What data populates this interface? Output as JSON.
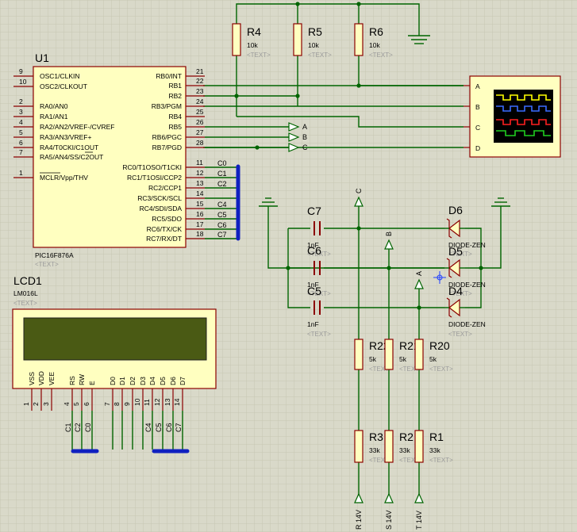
{
  "u1": {
    "ref": "U1",
    "part": "PIC16F876A",
    "placeholder": "<TEXT>",
    "left_pins": [
      {
        "num": "9",
        "name": "OSC1/CLKIN"
      },
      {
        "num": "10",
        "name": "OSC2/CLKOUT"
      },
      {
        "num": "2",
        "name": "RA0/AN0"
      },
      {
        "num": "3",
        "name": "RA1/AN1"
      },
      {
        "num": "4",
        "name": "RA2/AN2/VREF-/CVREF"
      },
      {
        "num": "5",
        "name": "RA3/AN3/VREF+"
      },
      {
        "num": "6",
        "name": "RA4/T0CKI/C1OUT"
      },
      {
        "num": "7",
        "name": "RA5/AN4/SS/C2OUT"
      },
      {
        "num": "1",
        "name": "MCLR/Vpp/THV"
      }
    ],
    "right_pins": [
      {
        "num": "21",
        "name": "RB0/INT"
      },
      {
        "num": "22",
        "name": "RB1"
      },
      {
        "num": "23",
        "name": "RB2"
      },
      {
        "num": "24",
        "name": "RB3/PGM"
      },
      {
        "num": "25",
        "name": "RB4"
      },
      {
        "num": "26",
        "name": "RB5"
      },
      {
        "num": "27",
        "name": "RB6/PGC"
      },
      {
        "num": "28",
        "name": "RB7/PGD"
      },
      {
        "num": "11",
        "name": "RC0/T1OSO/T1CKI"
      },
      {
        "num": "12",
        "name": "RC1/T1OSI/CCP2"
      },
      {
        "num": "13",
        "name": "RC2/CCP1"
      },
      {
        "num": "14",
        "name": "RC3/SCK/SCL"
      },
      {
        "num": "15",
        "name": "RC4/SDI/SDA"
      },
      {
        "num": "16",
        "name": "RC5/SDO"
      },
      {
        "num": "17",
        "name": "RC6/TX/CK"
      },
      {
        "num": "18",
        "name": "RC7/RX/DT"
      }
    ],
    "bus_labels": [
      "C0",
      "C1",
      "C2",
      "",
      "C4",
      "C5",
      "C6",
      "C7"
    ],
    "probe_labels": [
      "A",
      "B",
      "C"
    ]
  },
  "lcd": {
    "ref": "LCD1",
    "part": "LM016L",
    "placeholder": "<TEXT>",
    "pins": [
      {
        "num": "1",
        "name": "VSS"
      },
      {
        "num": "2",
        "name": "VDD"
      },
      {
        "num": "3",
        "name": "VEE"
      },
      {
        "num": "4",
        "name": "RS"
      },
      {
        "num": "5",
        "name": "RW"
      },
      {
        "num": "6",
        "name": "E"
      },
      {
        "num": "7",
        "name": "D0"
      },
      {
        "num": "8",
        "name": "D1"
      },
      {
        "num": "9",
        "name": "D2"
      },
      {
        "num": "10",
        "name": "D3"
      },
      {
        "num": "11",
        "name": "D4"
      },
      {
        "num": "12",
        "name": "D5"
      },
      {
        "num": "13",
        "name": "D6"
      },
      {
        "num": "14",
        "name": "D7"
      }
    ],
    "bus_labels_left": [
      "C1",
      "C2",
      "C0"
    ],
    "bus_labels_right": [
      "C4",
      "C5",
      "C6",
      "C7"
    ]
  },
  "top_resistors": [
    {
      "ref": "R4",
      "value": "10k",
      "placeholder": "<TEXT>"
    },
    {
      "ref": "R5",
      "value": "10k",
      "placeholder": "<TEXT>"
    },
    {
      "ref": "R6",
      "value": "10k",
      "placeholder": "<TEXT>"
    }
  ],
  "scope": {
    "channels": [
      "A",
      "B",
      "C",
      "D"
    ],
    "trace_colors": [
      "#ffff00",
      "#3a6cff",
      "#ff2020",
      "#20d020"
    ]
  },
  "capacitors": [
    {
      "ref": "C7",
      "value": "1nF",
      "placeholder": "<TEXT>"
    },
    {
      "ref": "C6",
      "value": "1nF",
      "placeholder": "<TEXT>"
    },
    {
      "ref": "C5",
      "value": "1nF",
      "placeholder": "<TEXT>"
    }
  ],
  "diodes": [
    {
      "ref": "D6",
      "part": "DIODE-ZEN",
      "placeholder": "<TEXT>"
    },
    {
      "ref": "D5",
      "part": "DIODE-ZEN",
      "placeholder": "<TEXT>"
    },
    {
      "ref": "D4",
      "part": "DIODE-ZEN",
      "placeholder": "<TEXT>"
    }
  ],
  "divider_upper": [
    {
      "ref": "R22",
      "value": "5k",
      "placeholder": "<TEXT>"
    },
    {
      "ref": "R21",
      "value": "5k",
      "placeholder": "<TEXT>"
    },
    {
      "ref": "R20",
      "value": "5k",
      "placeholder": "<TEXT>"
    }
  ],
  "divider_lower": [
    {
      "ref": "R3",
      "value": "33k",
      "placeholder": "<TEXT>"
    },
    {
      "ref": "R2",
      "value": "33k",
      "placeholder": "<TEXT>"
    },
    {
      "ref": "R1",
      "value": "33k",
      "placeholder": "<TEXT>"
    }
  ],
  "probe_tops": [
    "C",
    "B",
    "A"
  ],
  "terminals": [
    "R 14V",
    "S 14V",
    "T 14V"
  ],
  "colors": {
    "wire": "#006400",
    "body": "#ffffff",
    "outline": "#8b0000",
    "component_fill": "#ffffc0",
    "bus": "#1020c0",
    "lcd_screen": "#4a5a14",
    "grid": "#c6c6b3",
    "background": "#d9d9c9"
  }
}
